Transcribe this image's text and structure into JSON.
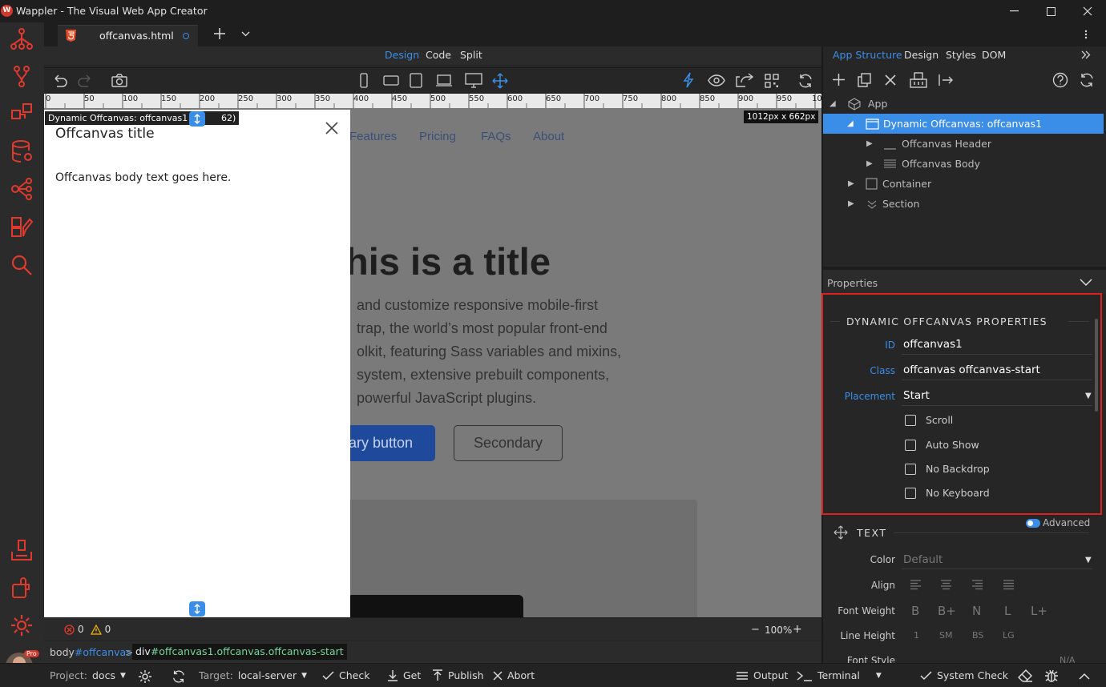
{
  "app": {
    "title": "Wappler - The Visual Web App Creator",
    "logo": "W"
  },
  "tab": {
    "label": "offcanvas.html"
  },
  "modes": [
    "Design",
    "Code",
    "Split"
  ],
  "right_tabs": [
    "App Structure",
    "Design",
    "Styles",
    "DOM"
  ],
  "ruler": [
    "0",
    "50",
    "100",
    "150",
    "200",
    "250",
    "300",
    "350",
    "400",
    "450",
    "500",
    "550",
    "600",
    "650",
    "700",
    "750",
    "800",
    "850",
    "900",
    "950",
    "10"
  ],
  "canvas": {
    "selection_badge": "Dynamic Offcanvas: offcanvas1 (40",
    "selection_badge_end": "62)",
    "size_badge": "1012px x 662px",
    "nav": [
      "Features",
      "Pricing",
      "FAQs",
      "About"
    ],
    "hero_title": "his is a title",
    "hero_lines": [
      "and customize responsive mobile-first",
      "trap, the world’s most popular front-end",
      "olkit, featuring Sass variables and mixins,",
      "system, extensive prebuilt components,",
      "powerful JavaScript plugins."
    ],
    "primary_btn": "ary button",
    "secondary_btn": "Secondary",
    "offcanvas_title": "Offcanvas title",
    "offcanvas_body": "Offcanvas body text goes here."
  },
  "bottom": {
    "errors": "0",
    "warnings": "0",
    "zoom": "100%"
  },
  "breadcrumb": {
    "item1_tag": "body",
    "item1_id": "#offcanvas",
    "sep": ">",
    "item2_tag": "div",
    "item2_rest": "#offcanvas1.offcanvas.offcanvas-start"
  },
  "status": {
    "project_label": "Project:",
    "project": "docs",
    "target_label": "Target:",
    "target": "local-server",
    "check": "Check",
    "get": "Get",
    "publish": "Publish",
    "abort": "Abort",
    "output": "Output",
    "terminal": "Terminal",
    "system_check": "System Check"
  },
  "tree": [
    {
      "label": "App"
    },
    {
      "label": "Dynamic Offcanvas: offcanvas1"
    },
    {
      "label": "Offcanvas Header"
    },
    {
      "label": "Offcanvas Body"
    },
    {
      "label": "Container"
    },
    {
      "label": "Section"
    }
  ],
  "properties": {
    "header": "Properties",
    "section_title": "DYNAMIC OFFCANVAS PROPERTIES",
    "id_label": "ID",
    "id_value": "offcanvas1",
    "class_label": "Class",
    "class_value": "offcanvas offcanvas-start",
    "placement_label": "Placement",
    "placement_value": "Start",
    "checks": [
      "Scroll",
      "Auto Show",
      "No Backdrop",
      "No Keyboard"
    ]
  },
  "text_section": {
    "title": "TEXT",
    "advanced": "Advanced",
    "color_label": "Color",
    "color_value": "Default",
    "align_label": "Align",
    "weight_label": "Font Weight",
    "weights": [
      "B",
      "B+",
      "N",
      "L",
      "L+"
    ],
    "lh_label": "Line Height",
    "lh": [
      "1",
      "SM",
      "BS",
      "LG"
    ],
    "style_label": "Font Style",
    "style_na": "N/A"
  },
  "colors": {
    "accent": "#3b8ee8",
    "highlight": "#3b8ee8",
    "red": "#e0201c",
    "pro": "#d0392c"
  }
}
